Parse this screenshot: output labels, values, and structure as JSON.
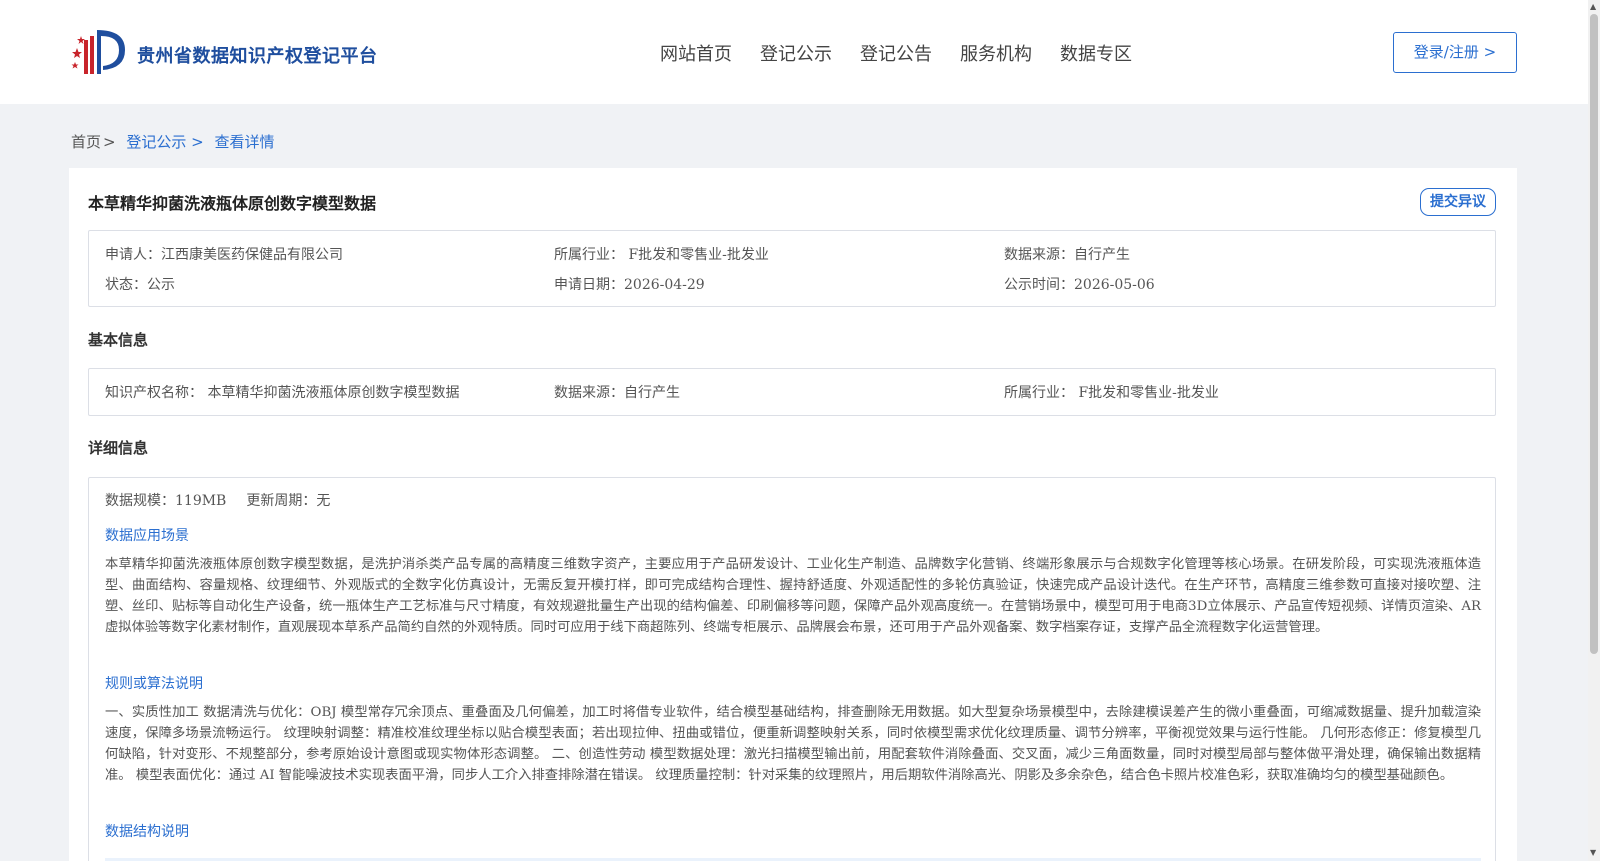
{
  "header": {
    "site_title": "贵州省数据知识产权登记平台",
    "nav": [
      "网站首页",
      "登记公示",
      "登记公告",
      "服务机构",
      "数据专区"
    ],
    "login_label": "登录/注册 >"
  },
  "breadcrumb": {
    "home": "首页",
    "sep": ">",
    "items": [
      "登记公示 >",
      "查看详情"
    ]
  },
  "detail": {
    "title": "本草精华抑菌洗液瓶体原创数字模型数据",
    "dispute_label": "提交异议",
    "summary": {
      "applicant": "申请人：江西康美医药保健品有限公司",
      "industry": "所属行业： F批发和零售业-批发业",
      "source": "数据来源：自行产生",
      "status": "状态：公示",
      "apply_date": "申请日期：2026-04-29",
      "publish_date": "公示时间：2026-05-06"
    },
    "basic_title": "基本信息",
    "basic": {
      "ip_name": "知识产权名称： 本草精华抑菌洗液瓶体原创数字模型数据",
      "source": "数据来源：自行产生",
      "industry": "所属行业： F批发和零售业-批发业"
    },
    "detail_title": "详细信息",
    "scale": "数据规模：119MB",
    "update_cycle": "更新周期：无",
    "scenario_title": "数据应用场景",
    "scenario_text": "本草精华抑菌洗液瓶体原创数字模型数据，是洗护消杀类产品专属的高精度三维数字资产，主要应用于产品研发设计、工业化生产制造、品牌数字化营销、终端形象展示与合规数字化管理等核心场景。在研发阶段，可实现洗液瓶体造型、曲面结构、容量规格、纹理细节、外观版式的全数字化仿真设计，无需反复开模打样，即可完成结构合理性、握持舒适度、外观适配性的多轮仿真验证，快速完成产品设计迭代。在生产环节，高精度三维参数可直接对接吹塑、注塑、丝印、贴标等自动化生产设备，统一瓶体生产工艺标准与尺寸精度，有效规避批量生产出现的结构偏差、印刷偏移等问题，保障产品外观高度统一。在营销场景中，模型可用于电商3D立体展示、产品宣传短视频、详情页渲染、AR虚拟体验等数字化素材制作，直观展现本草系产品简约自然的外观特质。同时可应用于线下商超陈列、终端专柜展示、品牌展会布景，还可用于产品外观备案、数字档案存证，支撑产品全流程数字化运营管理。",
    "rules_title": "规则或算法说明",
    "rules_text": "一、实质性加工 数据清洗与优化：OBJ 模型常存冗余顶点、重叠面及几何偏差，加工时将借专业软件，结合模型基础结构，排查删除无用数据。如大型复杂场景模型中，去除建模误差产生的微小重叠面，可缩减数据量、提升加载渲染速度，保障多场景流畅运行。 纹理映射调整：精准校准纹理坐标以贴合模型表面；若出现拉伸、扭曲或错位，便重新调整映射关系，同时依模型需求优化纹理质量、调节分辨率，平衡视觉效果与运行性能。 几何形态修正：修复模型几何缺陷，针对变形、不规整部分，参考原始设计意图或现实物体形态调整。 二、创造性劳动 模型数据处理：激光扫描模型输出前，用配套软件消除叠面、交叉面，减少三角面数量，同时对模型局部与整体做平滑处理，确保输出数据精准。 模型表面优化：通过 AI 智能噪波技术实现表面平滑，同步人工介入排查排除潜在错误。 纹理质量控制：针对采集的纹理照片，用后期软件消除高光、阴影及多余杂色，结合色卡照片校准色彩，获取准确均匀的模型基础颜色。",
    "structure_title": "数据结构说明"
  }
}
